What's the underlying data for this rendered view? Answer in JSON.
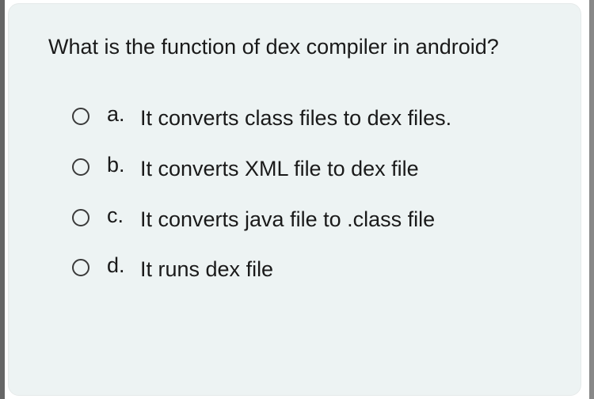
{
  "question": "What is the function of dex compiler in android?",
  "options": [
    {
      "letter": "a.",
      "text": "It converts class files to dex files."
    },
    {
      "letter": "b.",
      "text": "It converts XML file to dex file"
    },
    {
      "letter": "c.",
      "text": "It converts java file to .class file"
    },
    {
      "letter": "d.",
      "text": "It runs dex file"
    }
  ]
}
